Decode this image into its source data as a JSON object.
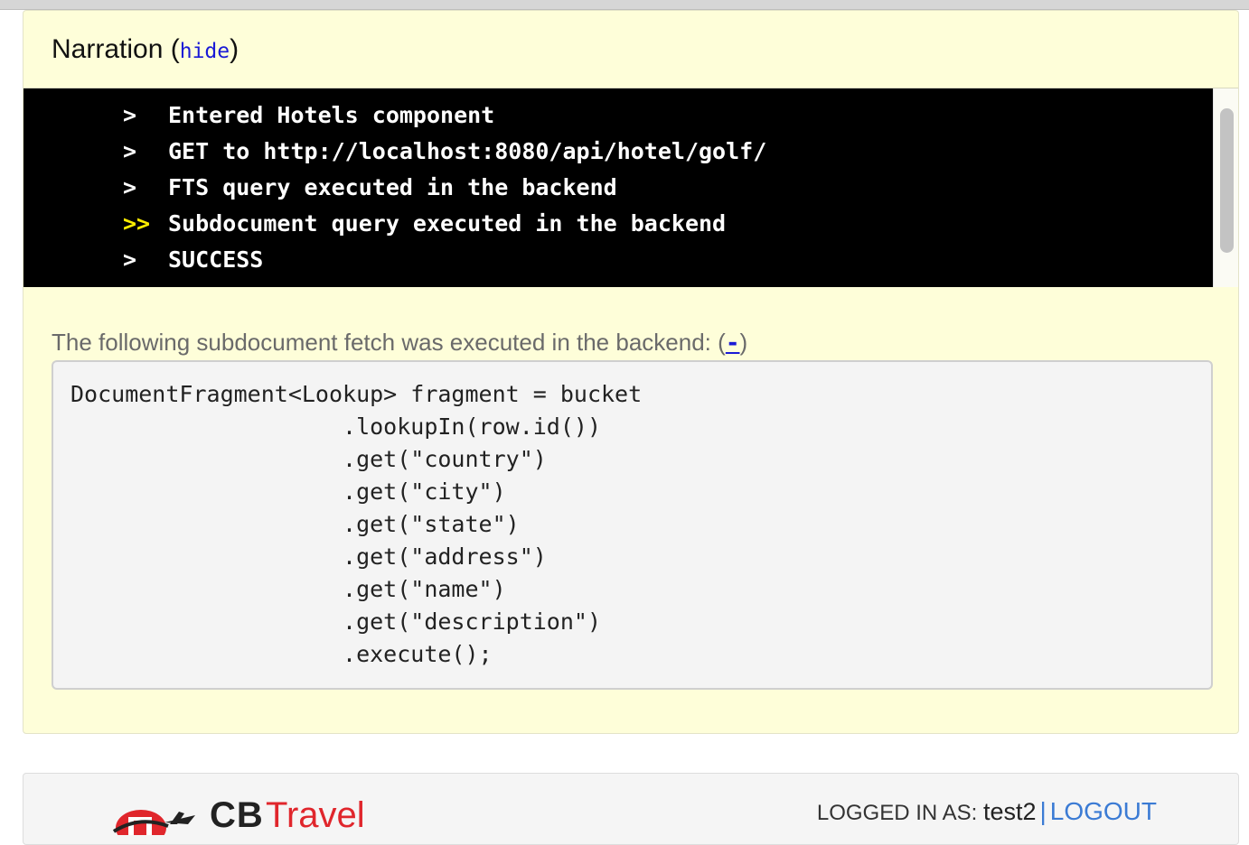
{
  "narration": {
    "title": "Narration",
    "paren_open": "(",
    "hide_label": "hide",
    "paren_close": ")"
  },
  "console": {
    "lines": [
      {
        "marker": ">",
        "text": "Entered Hotels component"
      },
      {
        "marker": ">",
        "text": "GET to http://localhost:8080/api/hotel/golf/"
      },
      {
        "marker": ">",
        "text": "FTS query executed in the backend"
      },
      {
        "marker": ">>",
        "text": "Subdocument query executed in the backend"
      },
      {
        "marker": ">",
        "text": "SUCCESS"
      }
    ]
  },
  "fetch": {
    "caption": "The following subdocument fetch was executed in the backend:",
    "toggle_open": "(",
    "toggle_label": "-",
    "toggle_close": ")",
    "code_lines": [
      "DocumentFragment<Lookup> fragment = bucket",
      "                    .lookupIn(row.id())",
      "                    .get(\"country\")",
      "                    .get(\"city\")",
      "                    .get(\"state\")",
      "                    .get(\"address\")",
      "                    .get(\"name\")",
      "                    .get(\"description\")",
      "                    .execute();"
    ]
  },
  "footer": {
    "logo_cb": "CB",
    "logo_travel": "Travel",
    "logged_in_label": "LOGGED IN AS:",
    "username": "test2",
    "separator": "|",
    "logout_label": "LOGOUT"
  },
  "colors": {
    "panel_bg": "#fefed9",
    "console_bg": "#000000",
    "current_marker": "#ffee00",
    "link": "#1a1ad6",
    "footer_link": "#3b7bd4",
    "logo_red": "#e0262c"
  }
}
